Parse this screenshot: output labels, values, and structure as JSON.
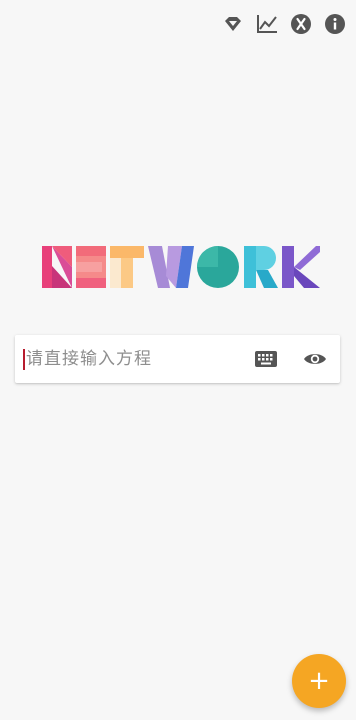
{
  "toolbar": {
    "icons": [
      "diamond-icon",
      "chart-icon",
      "x-circle-icon",
      "info-icon"
    ],
    "icon_color": "#555555"
  },
  "logo": {
    "text": "NETWORK",
    "colors": [
      "#e8407a",
      "#f37b8a",
      "#fbb869",
      "#a78bd6",
      "#4f76d9",
      "#2aa79b",
      "#3ec0d8",
      "#7b57c9"
    ]
  },
  "equation_input": {
    "placeholder": "请直接输入方程",
    "value": "",
    "caret_color": "#b71c2e"
  },
  "input_actions": {
    "keyboard_icon": "keyboard-icon",
    "eye_icon": "eye-icon"
  },
  "fab": {
    "label": "+",
    "color": "#f5a623"
  }
}
